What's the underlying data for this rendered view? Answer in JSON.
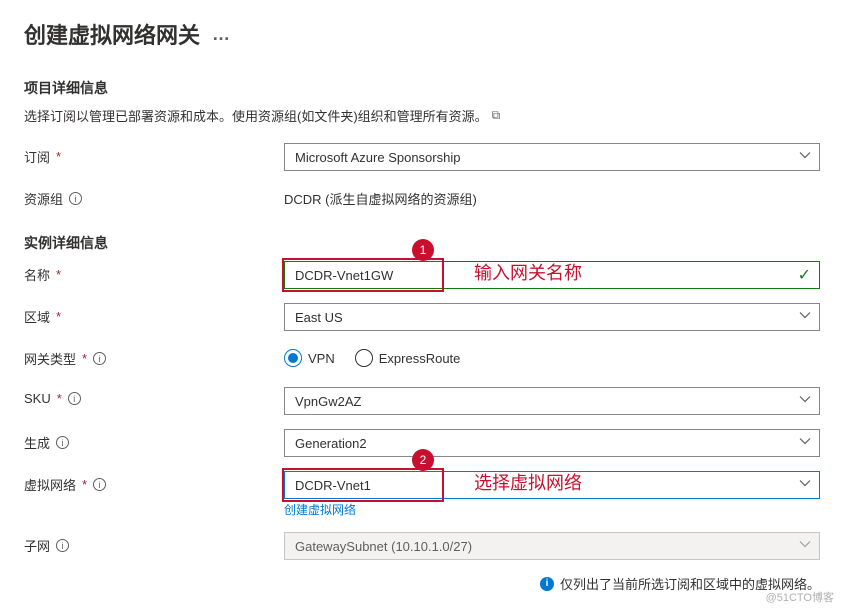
{
  "page": {
    "title": "创建虚拟网络网关"
  },
  "sections": {
    "project": {
      "title": "项目详细信息",
      "desc": "选择订阅以管理已部署资源和成本。使用资源组(如文件夹)组织和管理所有资源。"
    },
    "instance": {
      "title": "实例详细信息"
    }
  },
  "fields": {
    "subscription": {
      "label": "订阅",
      "value": "Microsoft Azure Sponsorship"
    },
    "resourceGroup": {
      "label": "资源组",
      "value": "DCDR (派生自虚拟网络的资源组)"
    },
    "name": {
      "label": "名称",
      "value": "DCDR-Vnet1GW"
    },
    "region": {
      "label": "区域",
      "value": "East US"
    },
    "gatewayType": {
      "label": "网关类型",
      "options": {
        "vpn": "VPN",
        "expressRoute": "ExpressRoute"
      },
      "selected": "vpn"
    },
    "sku": {
      "label": "SKU",
      "value": "VpnGw2AZ"
    },
    "generation": {
      "label": "生成",
      "value": "Generation2"
    },
    "vnet": {
      "label": "虚拟网络",
      "value": "DCDR-Vnet1",
      "createLink": "创建虚拟网络"
    },
    "subnet": {
      "label": "子网",
      "value": "GatewaySubnet (10.10.1.0/27)"
    }
  },
  "hint": {
    "text": "仅列出了当前所选订阅和区域中的虚拟网络。"
  },
  "annotations": {
    "badge1": "1",
    "text1": "输入网关名称",
    "badge2": "2",
    "text2": "选择虚拟网络"
  },
  "watermark": "@51CTO博客"
}
